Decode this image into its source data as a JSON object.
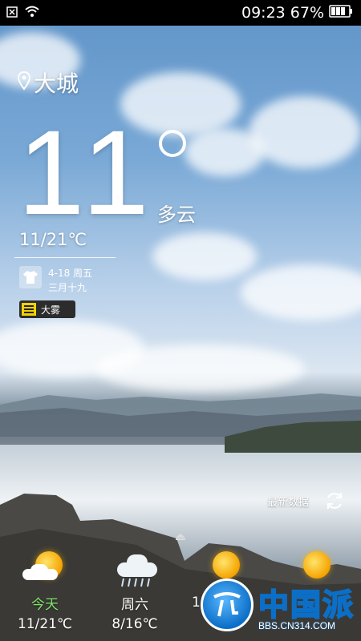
{
  "status_bar": {
    "time": "09:23",
    "battery": "67%"
  },
  "location": {
    "city": "大城"
  },
  "current": {
    "temperature": "11",
    "condition": "多云",
    "range": "11/21℃"
  },
  "date_info": {
    "date": "4-18 周五",
    "lunar": "三月十九"
  },
  "alert": {
    "label": "大雾",
    "color": "#f2d100"
  },
  "update": {
    "label": "最新数据"
  },
  "forecast": [
    {
      "day": "今天",
      "range": "11/21℃",
      "icon": "sun-cloud-icon",
      "highlight": true
    },
    {
      "day": "周六",
      "range": "8/16℃",
      "icon": "rain-cloud-icon",
      "highlight": false
    },
    {
      "day": "",
      "range": "1",
      "icon": "sun-icon",
      "highlight": false
    },
    {
      "day": "",
      "range": "",
      "icon": "sun-icon",
      "highlight": false
    }
  ],
  "watermark": {
    "text": "中国派",
    "url": "BBS.CN314.COM"
  },
  "colors": {
    "today_green": "#7ee36a"
  }
}
